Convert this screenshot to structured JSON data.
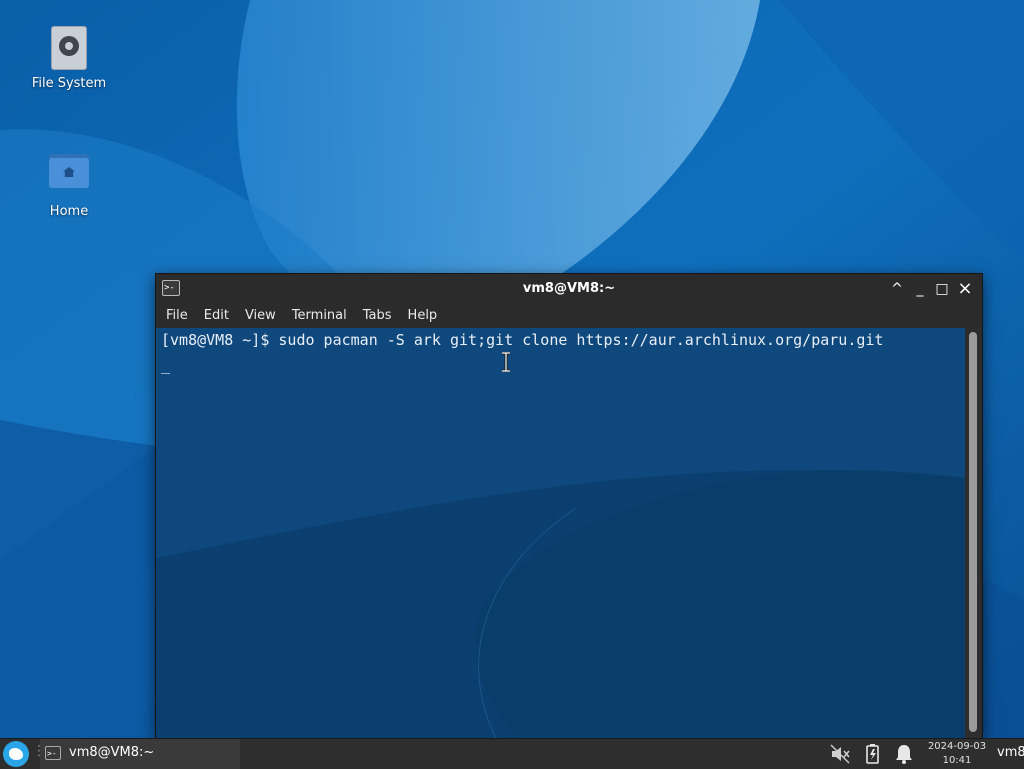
{
  "desktop": {
    "icons": [
      {
        "label": "File System",
        "icon": "drive-harddisk-icon"
      },
      {
        "label": "Home",
        "icon": "home-folder-icon"
      }
    ]
  },
  "terminal": {
    "title": "vm8@VM8:~",
    "menu": [
      "File",
      "Edit",
      "View",
      "Terminal",
      "Tabs",
      "Help"
    ],
    "lines": [
      "[vm8@VM8 ~]$ sudo pacman -S ark git;git clone https://aur.archlinux.org/paru.git",
      "_"
    ],
    "controls": {
      "shade": "^",
      "minimize": "_",
      "maximize": "□",
      "close": "×"
    }
  },
  "taskbar": {
    "launcher_sep": "⋮",
    "task_label": "vm8@VM8:~",
    "clock_date": "2024-09-03",
    "clock_time": "10:41",
    "user": "vm8",
    "tray_icons": [
      "muted-speaker-icon",
      "battery-charging-icon",
      "notification-bell-icon"
    ]
  },
  "colors": {
    "wallpaper_base": "#0b5ea6",
    "terminal_bg": "#0b3f6d",
    "titlebar": "#2b2b2b",
    "taskbar": "#2e2e2e"
  }
}
